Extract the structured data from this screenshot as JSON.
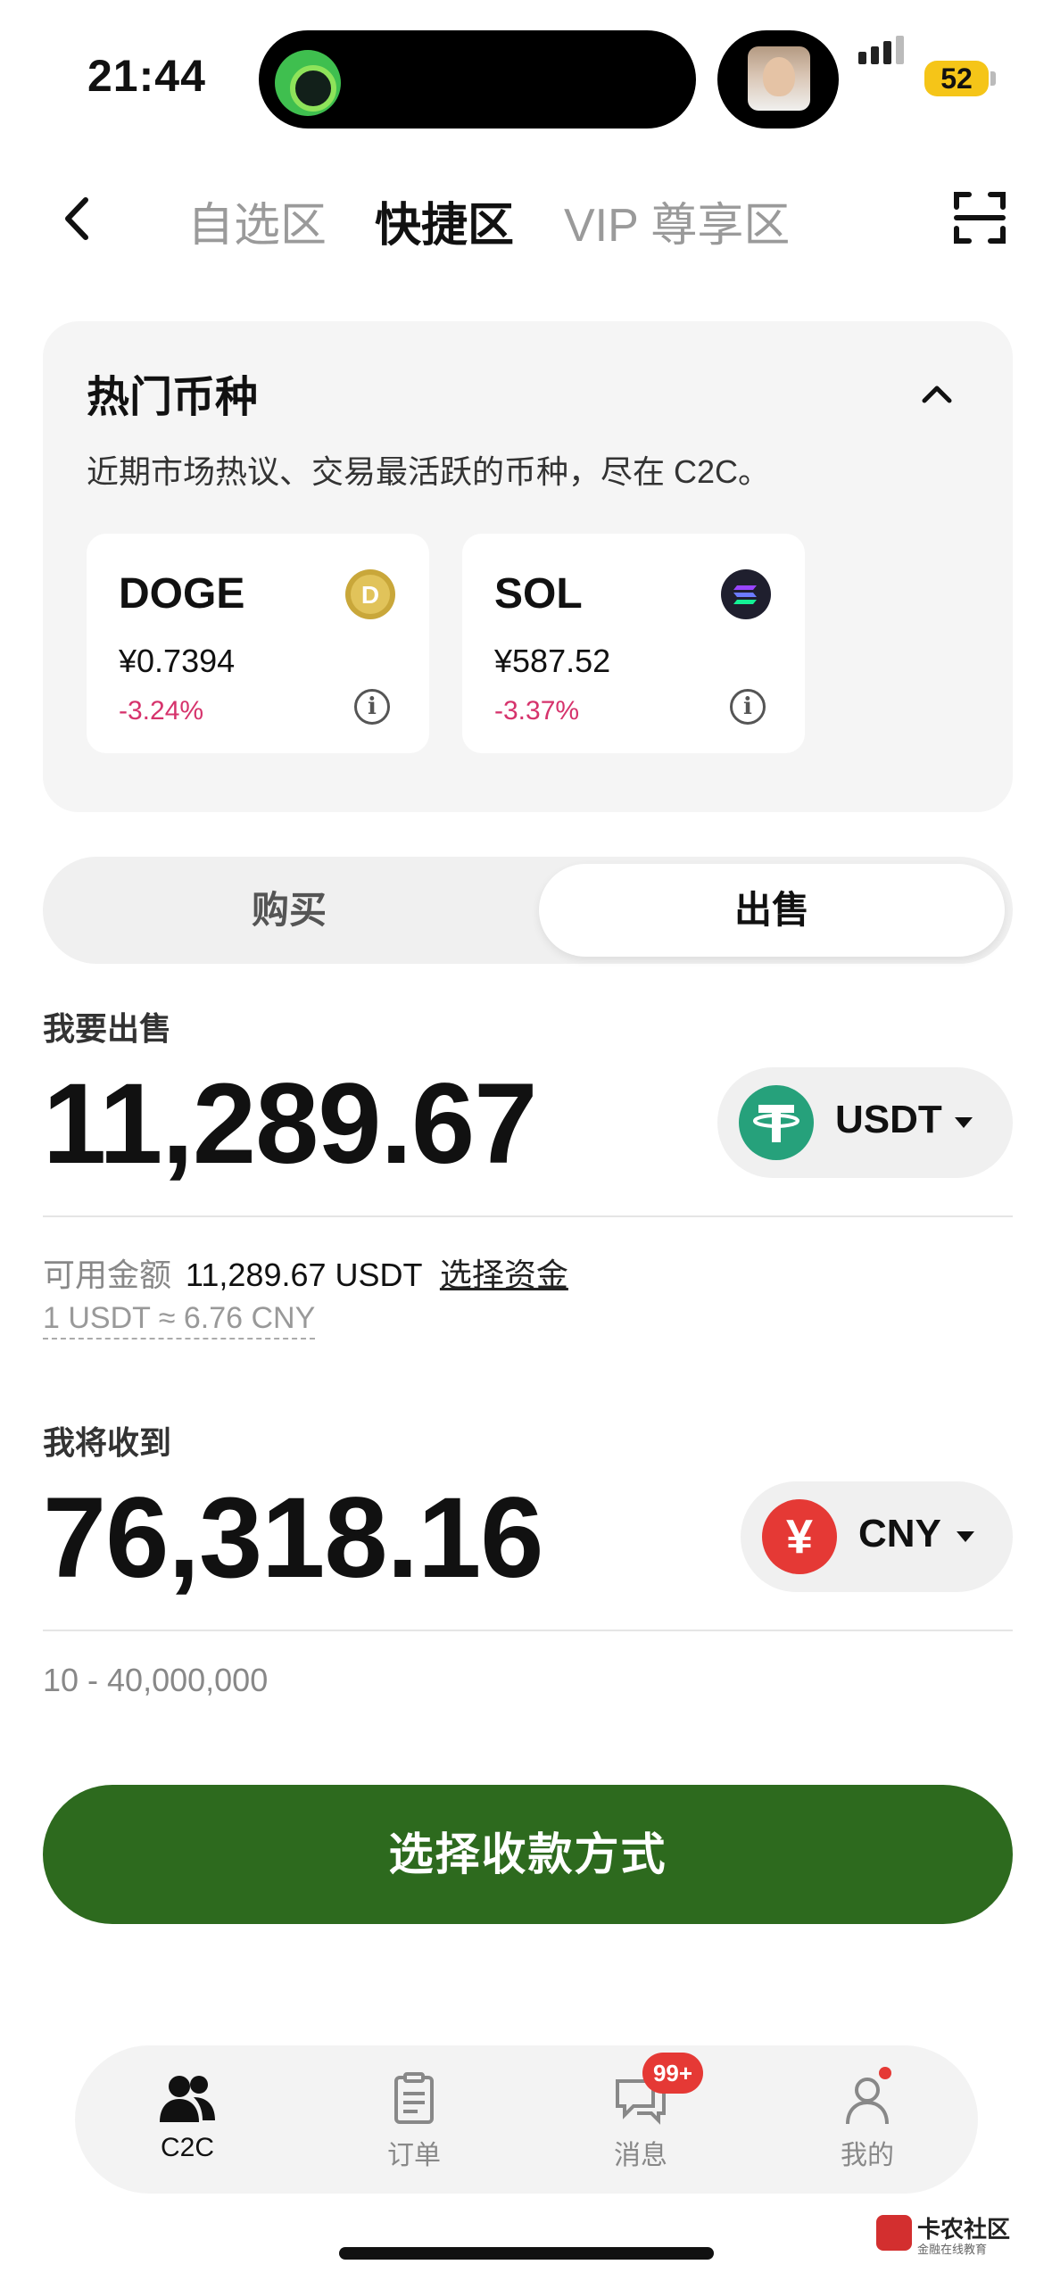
{
  "status_bar": {
    "time": "21:44",
    "battery": "52"
  },
  "nav": {
    "tabs": [
      {
        "label": "自选区",
        "active": false
      },
      {
        "label": "快捷区",
        "active": true
      },
      {
        "label": "VIP 尊享区",
        "active": false
      }
    ]
  },
  "hot": {
    "title": "热门币种",
    "description": "近期市场热议、交易最活跃的币种，尽在 C2C。",
    "coins": [
      {
        "name": "DOGE",
        "price": "¥0.7394",
        "change": "-3.24%",
        "icon": "doge-coin-icon"
      },
      {
        "name": "SOL",
        "price": "¥587.52",
        "change": "-3.37%",
        "icon": "sol-coin-icon"
      }
    ]
  },
  "mode": {
    "buy_label": "购买",
    "sell_label": "出售",
    "selected": "出售"
  },
  "sell": {
    "label": "我要出售",
    "amount": "11,289.67",
    "currency": "USDT",
    "available_prefix": "可用金额",
    "available_value": "11,289.67 USDT",
    "select_funds": "选择资金",
    "rate": "1 USDT ≈ 6.76 CNY"
  },
  "receive": {
    "label": "我将收到",
    "amount": "76,318.16",
    "currency": "CNY",
    "currency_symbol": "¥",
    "range": "10 - 40,000,000"
  },
  "cta_label": "选择收款方式",
  "tabbar": {
    "items": [
      {
        "label": "C2C",
        "icon": "users-icon",
        "active": true
      },
      {
        "label": "订单",
        "icon": "clipboard-icon",
        "active": false
      },
      {
        "label": "消息",
        "icon": "chat-icon",
        "active": false
      },
      {
        "label": "我的",
        "icon": "profile-icon",
        "active": false
      }
    ],
    "messages_badge": "99+"
  },
  "watermark": {
    "title": "卡农社区",
    "subtitle": "金融在线教育"
  },
  "colors": {
    "cta_green": "#2d6a1e",
    "negative_red": "#d6336c",
    "usdt_teal": "#26a17b",
    "cny_red": "#e53935",
    "battery_yellow": "#f5c518"
  }
}
